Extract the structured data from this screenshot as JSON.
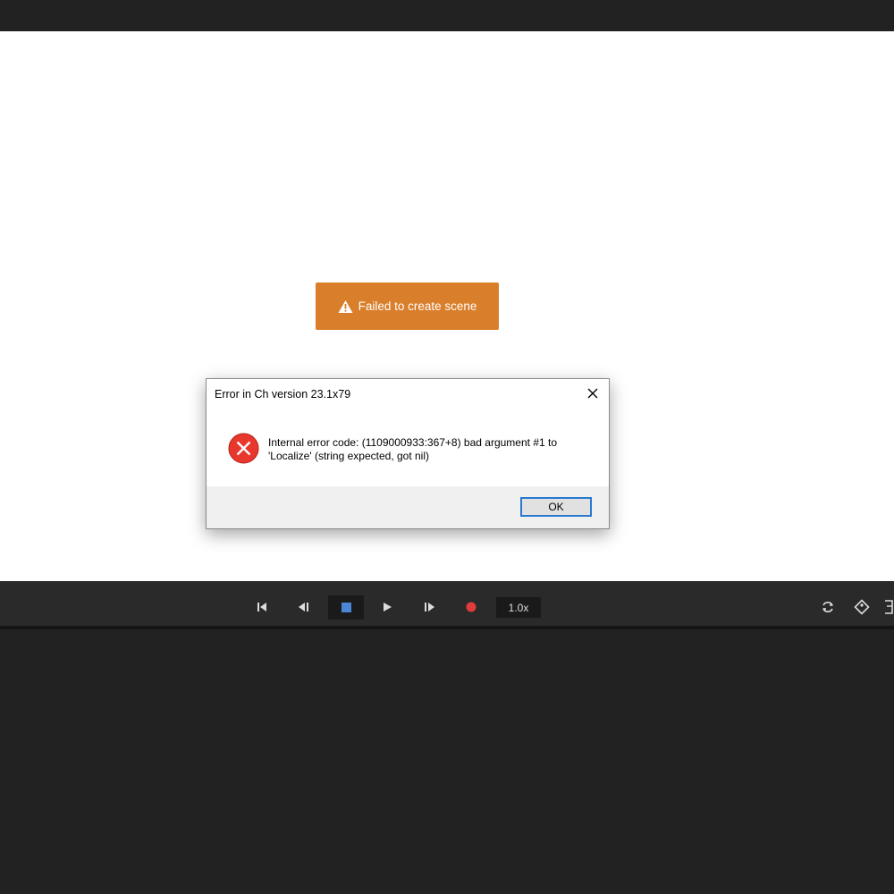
{
  "banner": {
    "text": "Failed to create scene",
    "icon": "warning-triangle-icon",
    "color": "#d97e2a"
  },
  "dialog": {
    "title": "Error in Ch version 23.1x79",
    "message": "Internal error code: (1109000933:367+8) bad argument #1 to 'Localize' (string expected, got nil)",
    "ok_label": "OK",
    "error_icon": "error-x-icon",
    "error_color": "#e8372c",
    "accent_color": "#2a78d0"
  },
  "transport": {
    "speed": "1.0x",
    "record_color": "#e23b3b",
    "stop_color": "#4a86d4",
    "icons": [
      "skip-to-start-icon",
      "step-back-icon",
      "stop-icon",
      "play-icon",
      "step-forward-icon",
      "record-icon",
      "loop-icon",
      "tag-icon"
    ]
  }
}
